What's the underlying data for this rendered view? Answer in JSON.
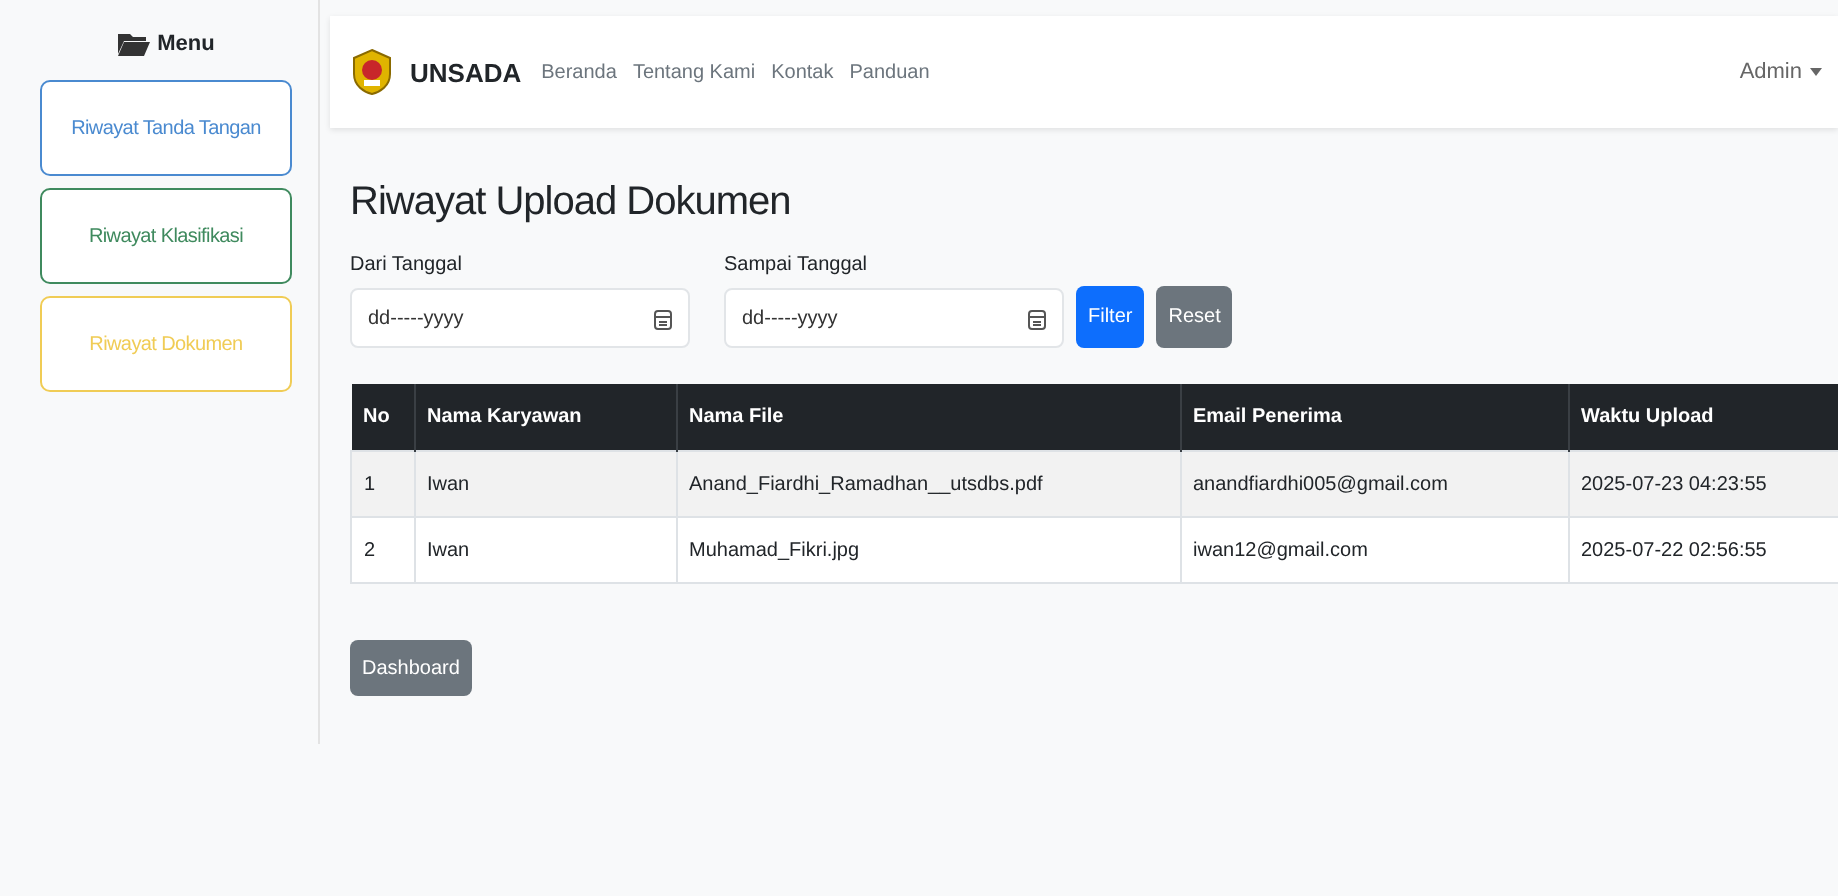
{
  "sidebar": {
    "heading": "Menu",
    "items": [
      {
        "label": "Riwayat Tanda Tangan",
        "color": "#4a8ad0"
      },
      {
        "label": "Riwayat Klasifikasi",
        "color": "#3f8a5e"
      },
      {
        "label": "Riwayat Dokumen",
        "color": "#f0cc55"
      }
    ]
  },
  "navbar": {
    "brand": "UNSADA",
    "links": [
      "Beranda",
      "Tentang Kami",
      "Kontak",
      "Panduan"
    ],
    "user": "Admin"
  },
  "page_title": "Riwayat Upload Dokumen",
  "filters": [
    {
      "label": "Dari Tanggal",
      "placeholder": "dd-----yyyy"
    },
    {
      "label": "Sampai Tanggal",
      "placeholder": "dd-----yyyy"
    }
  ],
  "buttons": {
    "filter": "Filter",
    "reset": "Reset"
  },
  "table": {
    "columns": [
      "No",
      "Nama Karyawan",
      "Nama File",
      "Email Penerima",
      "Waktu Upload"
    ],
    "rows": [
      [
        "1",
        "Iwan",
        "Anand_Fiardhi_Ramadhan__utsdbs.pdf",
        "anandfiardhi005@gmail.com",
        "2025-07-23 04:23:55"
      ],
      [
        "2",
        "Iwan",
        "Muhamad_Fikri.jpg",
        "iwan12@gmail.com",
        "2025-07-22 02:56:55"
      ]
    ]
  },
  "dashboard_button": "Dashboard"
}
